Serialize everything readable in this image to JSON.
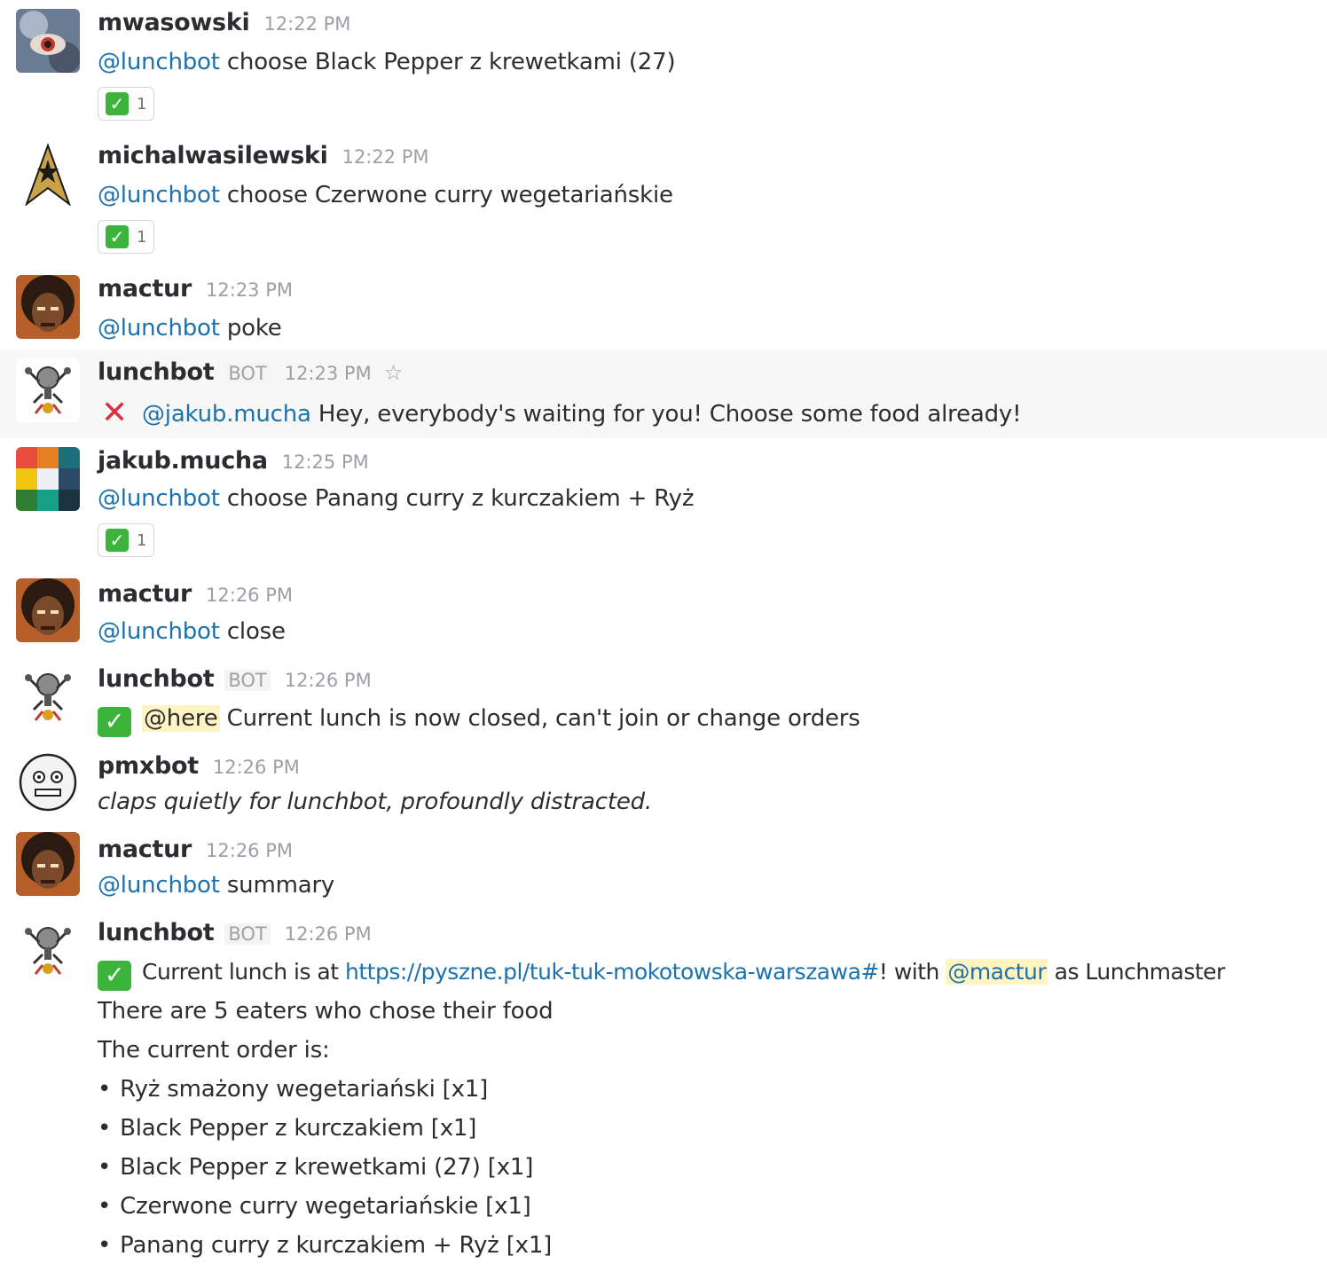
{
  "messages": [
    {
      "user": "mwasowski",
      "time": "12:22 PM",
      "mention": "@lunchbot",
      "text": " choose Black Pepper z krewetkami (27)",
      "reaction": {
        "icon": "white-check-mark",
        "count": "1"
      }
    },
    {
      "user": "michalwasilewski",
      "time": "12:22 PM",
      "mention": "@lunchbot",
      "text": " choose Czerwone curry wegetariańskie",
      "reaction": {
        "icon": "white-check-mark",
        "count": "1"
      }
    },
    {
      "user": "mactur",
      "time": "12:23 PM",
      "mention": "@lunchbot",
      "text": " poke"
    },
    {
      "user": "lunchbot",
      "badge": "BOT",
      "time": "12:23 PM",
      "icon": "x-mark",
      "mention": "@jakub.mucha",
      "text": " Hey, everybody's waiting for you! Choose some food already!"
    },
    {
      "user": "jakub.mucha",
      "time": "12:25 PM",
      "mention": "@lunchbot",
      "text": " choose Panang curry z kurczakiem + Ryż",
      "reaction": {
        "icon": "white-check-mark",
        "count": "1"
      }
    },
    {
      "user": "mactur",
      "time": "12:26 PM",
      "mention": "@lunchbot",
      "text": " close"
    },
    {
      "user": "lunchbot",
      "badge": "BOT",
      "time": "12:26 PM",
      "icon": "white-check-mark",
      "mention": "@here",
      "text": " Current lunch is now closed, can't join or change orders"
    },
    {
      "user": "pmxbot",
      "time": "12:26 PM",
      "text": "claps quietly for lunchbot, profoundly distracted."
    },
    {
      "user": "mactur",
      "time": "12:26 PM",
      "mention": "@lunchbot",
      "text": " summary"
    },
    {
      "user": "lunchbot",
      "badge": "BOT",
      "time": "12:26 PM",
      "icon": "white-check-mark",
      "line1_pre": "Current lunch is at ",
      "link": "https://pyszne.pl/tuk-tuk-mokotowska-warszawa#",
      "line1_mid": "! with ",
      "mention": "@mactur",
      "line1_post": " as Lunchmaster",
      "line2": "There are 5 eaters who chose their food",
      "line3": "The current order is:",
      "bullet": "•",
      "items": [
        "Ryż smażony wegetariański [x1]",
        "Black Pepper z kurczakiem [x1]",
        "Black Pepper z krewetkami (27) [x1]",
        "Czerwone curry wegetariańskie [x1]",
        "Panang curry z kurczakiem + Ryż [x1]"
      ]
    }
  ],
  "colors": {
    "mention": "#1d72ad",
    "highlight": "#fff4c2",
    "hover_row": "#f7f7f7",
    "check": "#3cb43c",
    "cross": "#dd2e44"
  }
}
